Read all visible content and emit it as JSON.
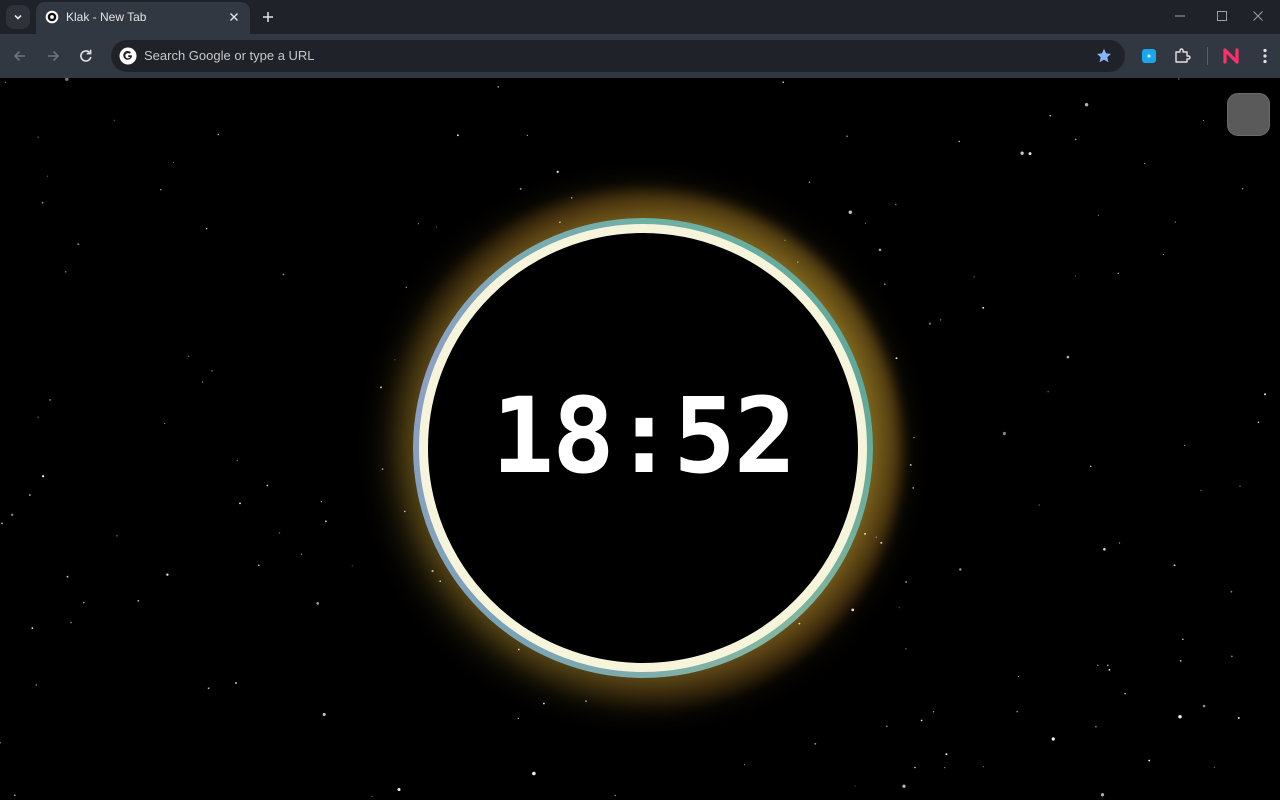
{
  "browser": {
    "tab_title": "Klak - New Tab",
    "omnibox_placeholder": "Search Google or type a URL",
    "icons": {
      "tab_search": "chevron-down-icon",
      "tab_favicon": "klak-favicon-icon",
      "tab_close": "close-icon",
      "new_tab": "plus-icon",
      "back": "arrow-left-icon",
      "forward": "arrow-right-icon",
      "reload": "reload-icon",
      "omnibox_logo": "google-g-icon",
      "bookmark": "star-icon",
      "extension1": "blue-square-extension-icon",
      "extensions": "puzzle-icon",
      "extension2": "n-logo-extension-icon",
      "menu": "kebab-menu-icon",
      "minimize": "minimize-icon",
      "maximize": "maximize-icon",
      "close_window": "close-window-icon"
    },
    "colors": {
      "tabstrip_bg": "#1f2329",
      "toolbar_bg": "#323842",
      "bookmark_star": "#8ab4f8"
    }
  },
  "page": {
    "clock_time": "18:52",
    "colors": {
      "background": "#000000",
      "ring_fill": "#f7f4dc",
      "glow": "#ffd84a"
    }
  }
}
